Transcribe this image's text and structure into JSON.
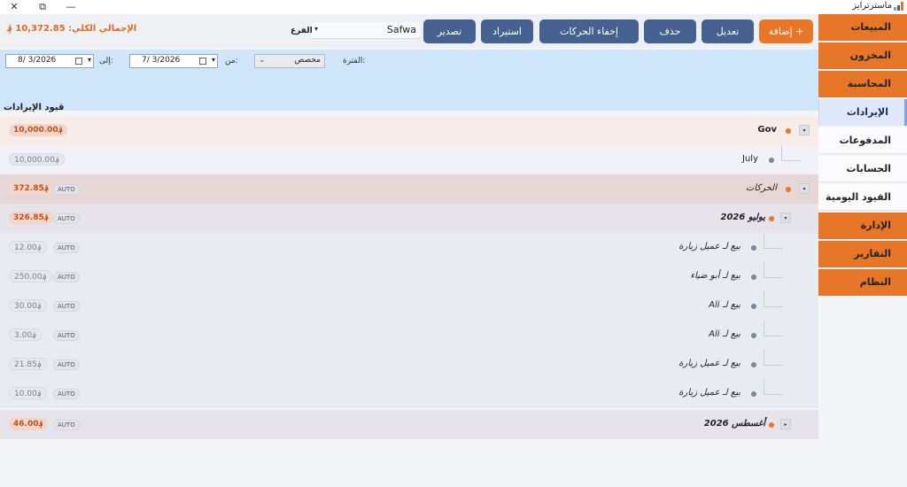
{
  "window": {
    "app_title": "ماسترترايز",
    "close_glyph": "✕",
    "restore_glyph": "⧉",
    "minimize_glyph": "—"
  },
  "nav": {
    "items": [
      {
        "label": "المبيعات"
      },
      {
        "label": "المخزون"
      },
      {
        "label": "المحاسبة"
      },
      {
        "label": "الإيرادات"
      },
      {
        "label": "المدفوعات"
      },
      {
        "label": "الحسابات"
      },
      {
        "label": "القيود اليومية"
      },
      {
        "label": "الإدارة"
      },
      {
        "label": "التقارير"
      },
      {
        "label": "النظام"
      }
    ]
  },
  "toolbar": {
    "add": "+ إضافة",
    "edit": "تعديل",
    "delete": "حذف",
    "hide_moves": "إخفاء الحركات",
    "import": "استيراد",
    "export": "تصدير",
    "branch_label": "الفرع",
    "branch_value": "Safwa",
    "total_label": "الإجمالي الكلي:",
    "total_value": "10,372.85 ؋"
  },
  "filter": {
    "period_label": "الفترة:",
    "period_value": "مخصص",
    "from_label": "من:",
    "from_date": "7/ 3/2026",
    "to_label": "إلى:",
    "to_date": "8/ 3/2026"
  },
  "section": {
    "title": "قيود الإيرادات"
  },
  "tree": {
    "gov": {
      "title": "Gov",
      "amount": "؋10,000.00",
      "toggle": "▾"
    },
    "july": {
      "title": "July",
      "amount": "؋10,000.00"
    },
    "moves": {
      "title": "الحركات",
      "amount": "؋372.85",
      "auto": "AUTO",
      "toggle": "▾"
    },
    "month1": {
      "title": "يوليو 2026",
      "amount": "؋326.85",
      "auto": "AUTO",
      "toggle": "▾"
    },
    "tx": [
      {
        "title": "بيع لـ عميل زيارة",
        "amount": "؋12.00",
        "auto": "AUTO"
      },
      {
        "title": "بيع لـ أبو ضياء",
        "amount": "؋250.00",
        "auto": "AUTO"
      },
      {
        "title": "بيع لـ Ali",
        "amount": "؋30.00",
        "auto": "AUTO"
      },
      {
        "title": "بيع لـ Ali",
        "amount": "؋3.00",
        "auto": "AUTO"
      },
      {
        "title": "بيع لـ عميل زيارة",
        "amount": "؋21.85",
        "auto": "AUTO"
      },
      {
        "title": "بيع لـ عميل زيارة",
        "amount": "؋10.00",
        "auto": "AUTO"
      }
    ],
    "month2": {
      "title": "أغسطس 2026",
      "amount": "؋46.00",
      "auto": "AUTO",
      "toggle": "▸"
    }
  }
}
